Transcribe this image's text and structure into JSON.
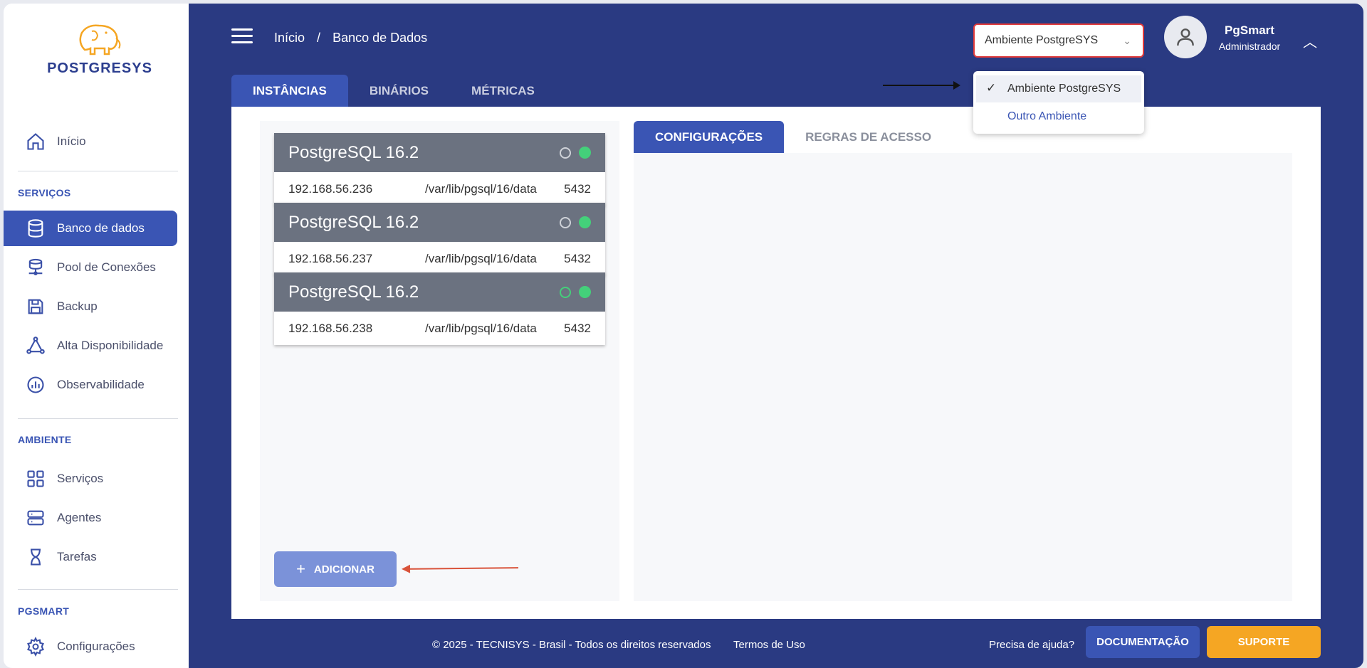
{
  "logo": {
    "text": "POSTGRESYS"
  },
  "sidebar": {
    "home": "Início",
    "sections": {
      "services": "SERVIÇOS",
      "environment": "AMBIENTE",
      "pgsmart": "PGSMART"
    },
    "services_items": [
      "Banco de dados",
      "Pool de Conexões",
      "Backup",
      "Alta Disponibilidade",
      "Observabilidade"
    ],
    "environment_items": [
      "Serviços",
      "Agentes",
      "Tarefas"
    ],
    "pgsmart_items": [
      "Configurações"
    ]
  },
  "header": {
    "breadcrumb": [
      "Início",
      "/",
      "Banco de Dados"
    ],
    "environment_select": "Ambiente PostgreSYS",
    "user_name": "PgSmart",
    "user_role": "Administrador"
  },
  "tabs": [
    "INSTÂNCIAS",
    "BINÁRIOS",
    "MÉTRICAS"
  ],
  "instances": [
    {
      "title": "PostgreSQL 16.2",
      "ip": "192.168.56.236",
      "path": "/var/lib/pgsql/16/data",
      "port": "5432"
    },
    {
      "title": "PostgreSQL 16.2",
      "ip": "192.168.56.237",
      "path": "/var/lib/pgsql/16/data",
      "port": "5432"
    },
    {
      "title": "PostgreSQL 16.2",
      "ip": "192.168.56.238",
      "path": "/var/lib/pgsql/16/data",
      "port": "5432"
    }
  ],
  "add_button": "ADICIONAR",
  "right_tabs": [
    "CONFIGURAÇÕES",
    "REGRAS DE ACESSO"
  ],
  "dropdown": {
    "options": [
      "Ambiente PostgreSYS",
      "Outro Ambiente"
    ]
  },
  "footer": {
    "copyright": "© 2025 - TECNISYS - Brasil - Todos os direitos reservados",
    "terms": "Termos de Uso",
    "help": "Precisa de ajuda?",
    "doc_button": "DOCUMENTAÇÃO",
    "support_button": "SUPORTE"
  },
  "colors": {
    "primary": "#3a55b4",
    "main_bg": "#2a3a82",
    "status_green": "#44d07a",
    "accent_orange": "#f5a623"
  }
}
